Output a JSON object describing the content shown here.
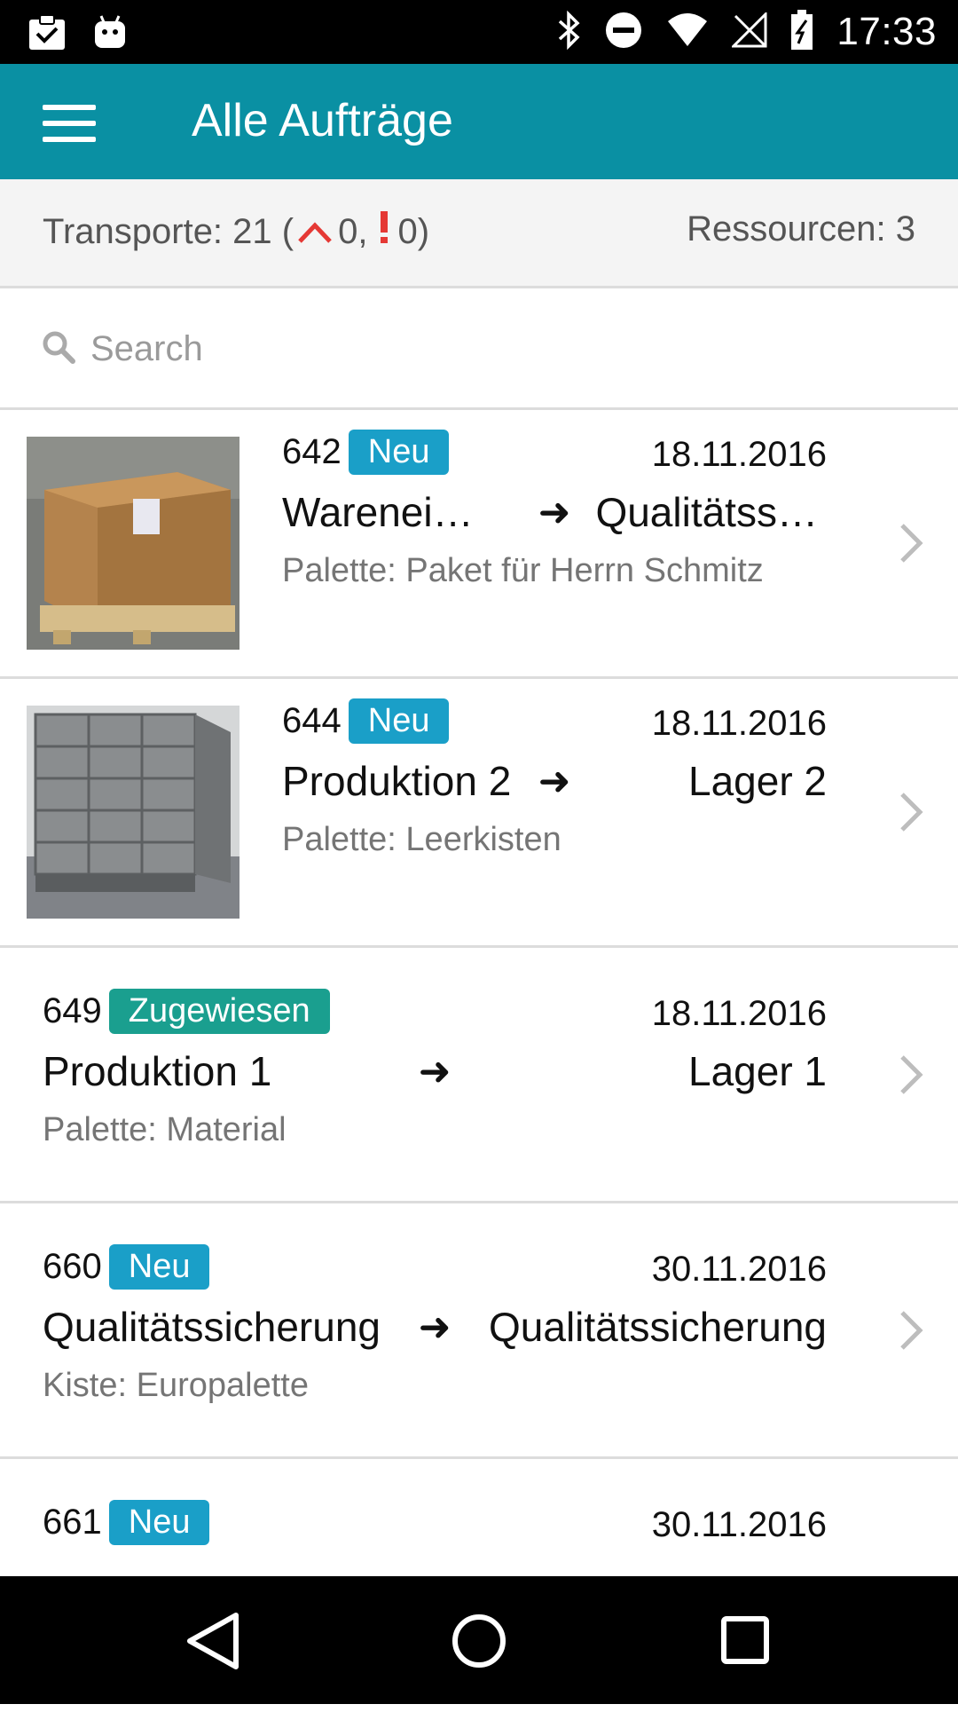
{
  "status_bar": {
    "time": "17:33",
    "left_icons": [
      "clipboard-check-icon",
      "android-icon"
    ],
    "right_icons": [
      "bluetooth-icon",
      "do-not-disturb-icon",
      "wifi-icon",
      "no-signal-icon",
      "battery-icon"
    ]
  },
  "app_bar": {
    "title": "Alle Aufträge",
    "menu_icon": "hamburger-menu-icon",
    "color": "#0a90a3"
  },
  "summary": {
    "transports_label": "Transporte: 21 (",
    "urgent_count": "0,",
    "warning_count": "0)",
    "resources_label": "Ressourcen: 3",
    "urgent_icon": "chevron-up-icon",
    "warning_icon": "exclamation-icon",
    "alert_color": "#e53935"
  },
  "search": {
    "placeholder": "Search",
    "value": ""
  },
  "orders": [
    {
      "number": "642",
      "status": "Neu",
      "date": "18.11.2016",
      "from": "Warenei…",
      "to": "Qualitätssic…",
      "subtitle": "Palette: Paket für Herrn Schmitz",
      "image": "cardboard-box-on-pallet"
    },
    {
      "number": "644",
      "status": "Neu",
      "date": "18.11.2016",
      "from": "Produktion 2",
      "to": "Lager 2",
      "subtitle": "Palette: Leerkisten",
      "image": "stacked-metal-crates"
    },
    {
      "number": "649",
      "status": "Zugewiesen",
      "date": "18.11.2016",
      "from": "Produktion 1",
      "to": "Lager 1",
      "subtitle": "Palette: Material"
    },
    {
      "number": "660",
      "status": "Neu",
      "date": "30.11.2016",
      "from": "Qualitätssicherung",
      "to": "Qualitätssicherung",
      "subtitle": "Kiste: Europalette"
    },
    {
      "number": "661",
      "status": "Neu",
      "date": "30.11.2016"
    }
  ],
  "route_arrow": "➜",
  "badge_colors": {
    "Neu": "#1a9fc8",
    "Zugewiesen": "#1a9f8f"
  },
  "nav_bar": {
    "buttons": [
      "back-icon",
      "home-icon",
      "recents-icon"
    ]
  }
}
